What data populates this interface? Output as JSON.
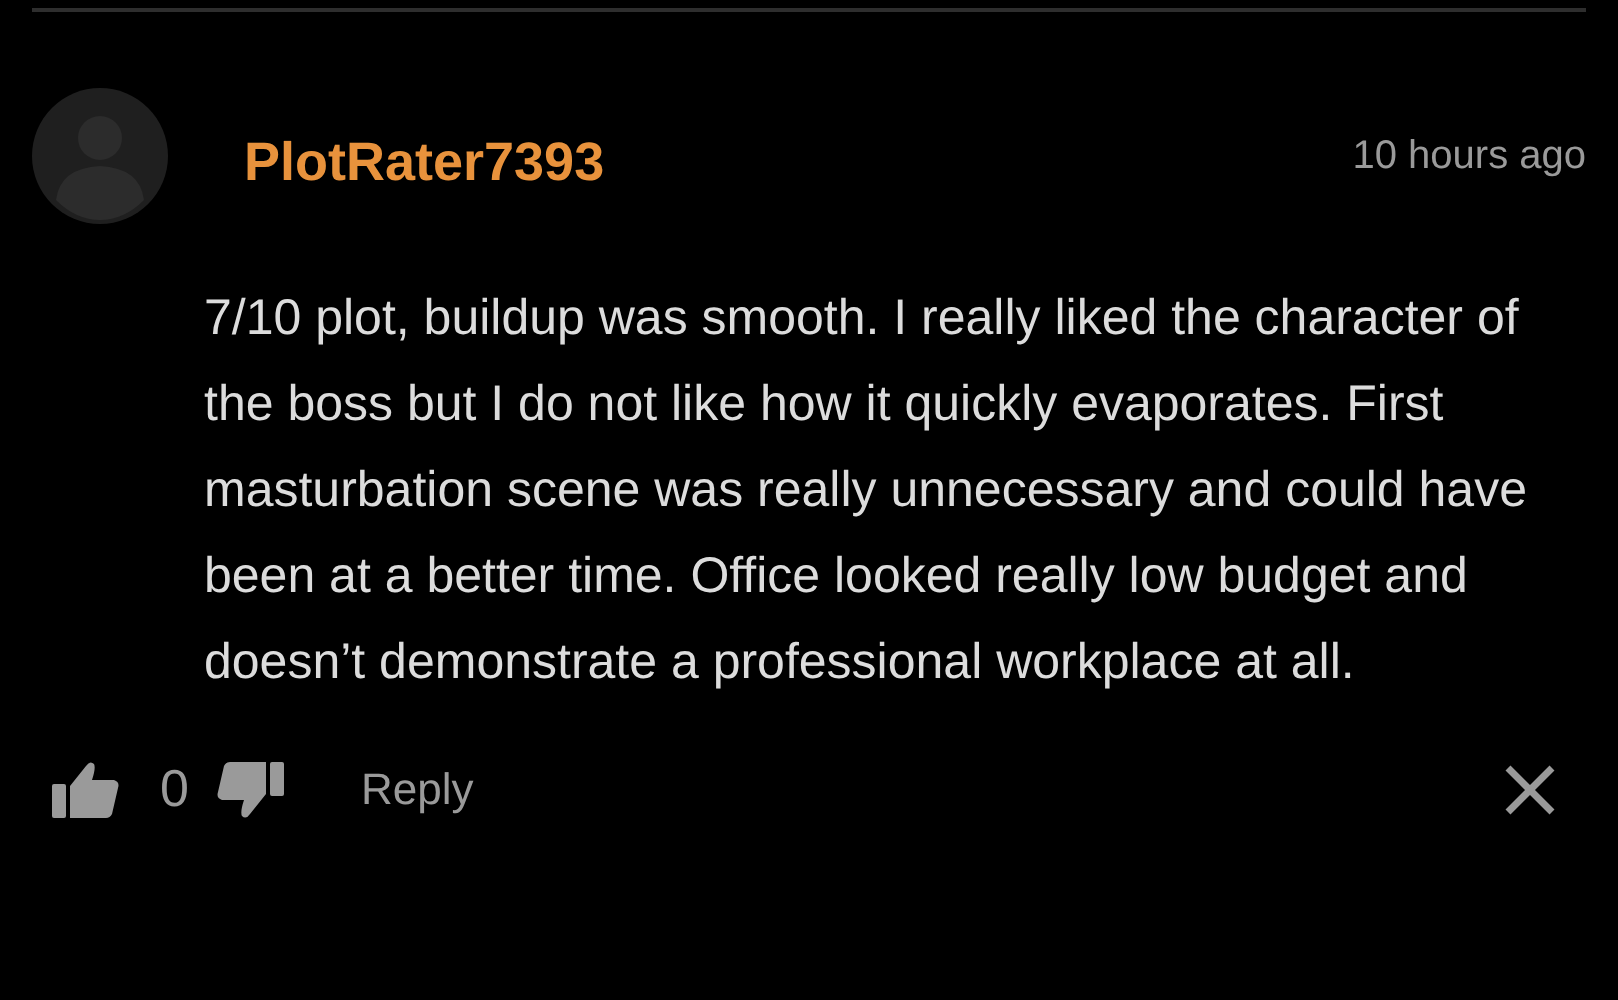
{
  "comment": {
    "username": "PlotRater7393",
    "time": "10 hours ago",
    "text": "7/10 plot, buildup was smooth. I really liked the character of the boss but I do not like how it quickly evaporates. First masturbation scene was really unnecessary and could have been at a better time. Office looked really low budget and doesn’t demonstrate a professional workplace at all.",
    "votes": "0",
    "reply": "Reply"
  }
}
